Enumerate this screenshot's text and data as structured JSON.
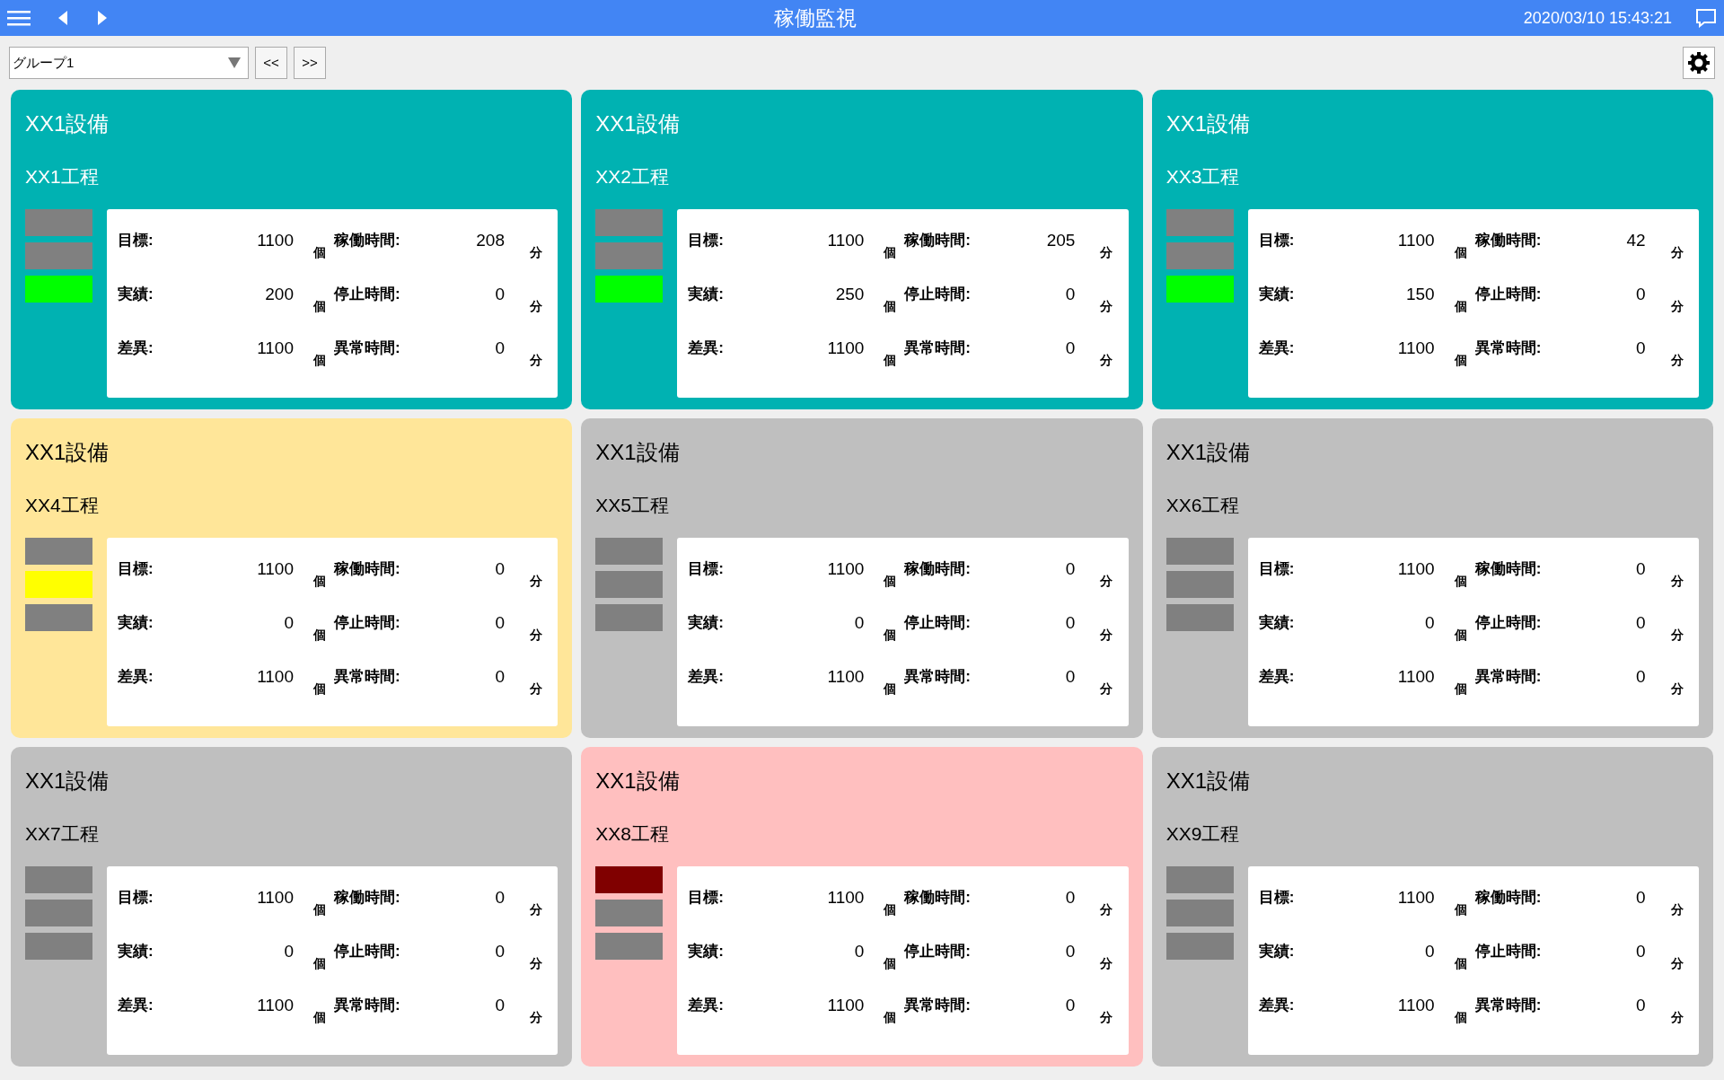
{
  "header": {
    "title": "稼働監視",
    "datetime": "2020/03/10 15:43:21"
  },
  "toolbar": {
    "group_select": "グループ1",
    "prev_button": "<<",
    "next_button": ">>"
  },
  "cards": [
    {
      "kind": "running",
      "title": "XX1設備",
      "process": "XX1工程",
      "lamps": [
        {
          "color": "#808080"
        },
        {
          "color": "#808080"
        },
        {
          "color": "#00ff00"
        }
      ],
      "counts": [
        {
          "label": "目標:",
          "value": "1100",
          "unit": "個"
        },
        {
          "label": "実績:",
          "value": "200",
          "unit": "個"
        },
        {
          "label": "差異:",
          "value": "1100",
          "unit": "個"
        }
      ],
      "times": [
        {
          "label": "稼働時間:",
          "value": "208",
          "unit": "分"
        },
        {
          "label": "停止時間:",
          "value": "0",
          "unit": "分"
        },
        {
          "label": "異常時間:",
          "value": "0",
          "unit": "分"
        }
      ]
    },
    {
      "kind": "running",
      "title": "XX1設備",
      "process": "XX2工程",
      "lamps": [
        {
          "color": "#808080"
        },
        {
          "color": "#808080"
        },
        {
          "color": "#00ff00"
        }
      ],
      "counts": [
        {
          "label": "目標:",
          "value": "1100",
          "unit": "個"
        },
        {
          "label": "実績:",
          "value": "250",
          "unit": "個"
        },
        {
          "label": "差異:",
          "value": "1100",
          "unit": "個"
        }
      ],
      "times": [
        {
          "label": "稼働時間:",
          "value": "205",
          "unit": "分"
        },
        {
          "label": "停止時間:",
          "value": "0",
          "unit": "分"
        },
        {
          "label": "異常時間:",
          "value": "0",
          "unit": "分"
        }
      ]
    },
    {
      "kind": "running",
      "title": "XX1設備",
      "process": "XX3工程",
      "lamps": [
        {
          "color": "#808080"
        },
        {
          "color": "#808080"
        },
        {
          "color": "#00ff00"
        }
      ],
      "counts": [
        {
          "label": "目標:",
          "value": "1100",
          "unit": "個"
        },
        {
          "label": "実績:",
          "value": "150",
          "unit": "個"
        },
        {
          "label": "差異:",
          "value": "1100",
          "unit": "個"
        }
      ],
      "times": [
        {
          "label": "稼働時間:",
          "value": "42",
          "unit": "分"
        },
        {
          "label": "停止時間:",
          "value": "0",
          "unit": "分"
        },
        {
          "label": "異常時間:",
          "value": "0",
          "unit": "分"
        }
      ]
    },
    {
      "kind": "warning",
      "title": "XX1設備",
      "process": "XX4工程",
      "lamps": [
        {
          "color": "#808080"
        },
        {
          "color": "#ffff00"
        },
        {
          "color": "#808080"
        }
      ],
      "counts": [
        {
          "label": "目標:",
          "value": "1100",
          "unit": "個"
        },
        {
          "label": "実績:",
          "value": "0",
          "unit": "個"
        },
        {
          "label": "差異:",
          "value": "1100",
          "unit": "個"
        }
      ],
      "times": [
        {
          "label": "稼働時間:",
          "value": "0",
          "unit": "分"
        },
        {
          "label": "停止時間:",
          "value": "0",
          "unit": "分"
        },
        {
          "label": "異常時間:",
          "value": "0",
          "unit": "分"
        }
      ]
    },
    {
      "kind": "stopped",
      "title": "XX1設備",
      "process": "XX5工程",
      "lamps": [
        {
          "color": "#808080"
        },
        {
          "color": "#808080"
        },
        {
          "color": "#808080"
        }
      ],
      "counts": [
        {
          "label": "目標:",
          "value": "1100",
          "unit": "個"
        },
        {
          "label": "実績:",
          "value": "0",
          "unit": "個"
        },
        {
          "label": "差異:",
          "value": "1100",
          "unit": "個"
        }
      ],
      "times": [
        {
          "label": "稼働時間:",
          "value": "0",
          "unit": "分"
        },
        {
          "label": "停止時間:",
          "value": "0",
          "unit": "分"
        },
        {
          "label": "異常時間:",
          "value": "0",
          "unit": "分"
        }
      ]
    },
    {
      "kind": "stopped",
      "title": "XX1設備",
      "process": "XX6工程",
      "lamps": [
        {
          "color": "#808080"
        },
        {
          "color": "#808080"
        },
        {
          "color": "#808080"
        }
      ],
      "counts": [
        {
          "label": "目標:",
          "value": "1100",
          "unit": "個"
        },
        {
          "label": "実績:",
          "value": "0",
          "unit": "個"
        },
        {
          "label": "差異:",
          "value": "1100",
          "unit": "個"
        }
      ],
      "times": [
        {
          "label": "稼働時間:",
          "value": "0",
          "unit": "分"
        },
        {
          "label": "停止時間:",
          "value": "0",
          "unit": "分"
        },
        {
          "label": "異常時間:",
          "value": "0",
          "unit": "分"
        }
      ]
    },
    {
      "kind": "stopped",
      "title": "XX1設備",
      "process": "XX7工程",
      "lamps": [
        {
          "color": "#808080"
        },
        {
          "color": "#808080"
        },
        {
          "color": "#808080"
        }
      ],
      "counts": [
        {
          "label": "目標:",
          "value": "1100",
          "unit": "個"
        },
        {
          "label": "実績:",
          "value": "0",
          "unit": "個"
        },
        {
          "label": "差異:",
          "value": "1100",
          "unit": "個"
        }
      ],
      "times": [
        {
          "label": "稼働時間:",
          "value": "0",
          "unit": "分"
        },
        {
          "label": "停止時間:",
          "value": "0",
          "unit": "分"
        },
        {
          "label": "異常時間:",
          "value": "0",
          "unit": "分"
        }
      ]
    },
    {
      "kind": "alarm",
      "title": "XX1設備",
      "process": "XX8工程",
      "lamps": [
        {
          "color": "#800000"
        },
        {
          "color": "#808080"
        },
        {
          "color": "#808080"
        }
      ],
      "counts": [
        {
          "label": "目標:",
          "value": "1100",
          "unit": "個"
        },
        {
          "label": "実績:",
          "value": "0",
          "unit": "個"
        },
        {
          "label": "差異:",
          "value": "1100",
          "unit": "個"
        }
      ],
      "times": [
        {
          "label": "稼働時間:",
          "value": "0",
          "unit": "分"
        },
        {
          "label": "停止時間:",
          "value": "0",
          "unit": "分"
        },
        {
          "label": "異常時間:",
          "value": "0",
          "unit": "分"
        }
      ]
    },
    {
      "kind": "stopped",
      "title": "XX1設備",
      "process": "XX9工程",
      "lamps": [
        {
          "color": "#808080"
        },
        {
          "color": "#808080"
        },
        {
          "color": "#808080"
        }
      ],
      "counts": [
        {
          "label": "目標:",
          "value": "1100",
          "unit": "個"
        },
        {
          "label": "実績:",
          "value": "0",
          "unit": "個"
        },
        {
          "label": "差異:",
          "value": "1100",
          "unit": "個"
        }
      ],
      "times": [
        {
          "label": "稼働時間:",
          "value": "0",
          "unit": "分"
        },
        {
          "label": "停止時間:",
          "value": "0",
          "unit": "分"
        },
        {
          "label": "異常時間:",
          "value": "0",
          "unit": "分"
        }
      ]
    }
  ]
}
